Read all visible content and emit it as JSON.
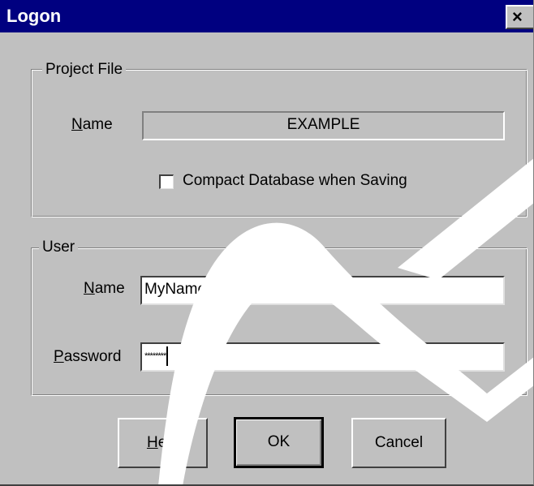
{
  "window": {
    "title": "Logon",
    "close_glyph": "×"
  },
  "project_file": {
    "legend": "Project File",
    "name_label_mnemonic": "N",
    "name_label_rest": "ame",
    "name_value": "EXAMPLE",
    "compact_label": "Compact Database when Saving",
    "compact_checked": false
  },
  "user": {
    "legend": "User",
    "name_label_mnemonic": "N",
    "name_label_rest": "ame",
    "name_value": "MyName",
    "password_label_mnemonic": "P",
    "password_label_rest": "assword",
    "password_value": "********"
  },
  "buttons": {
    "help_mnemonic": "H",
    "help_rest": "elp",
    "ok_label": "OK",
    "cancel_label": "Cancel"
  },
  "colors": {
    "titlebar": "#000080",
    "dialog_face": "#c0c0c0",
    "watermark": "#ffffff"
  }
}
